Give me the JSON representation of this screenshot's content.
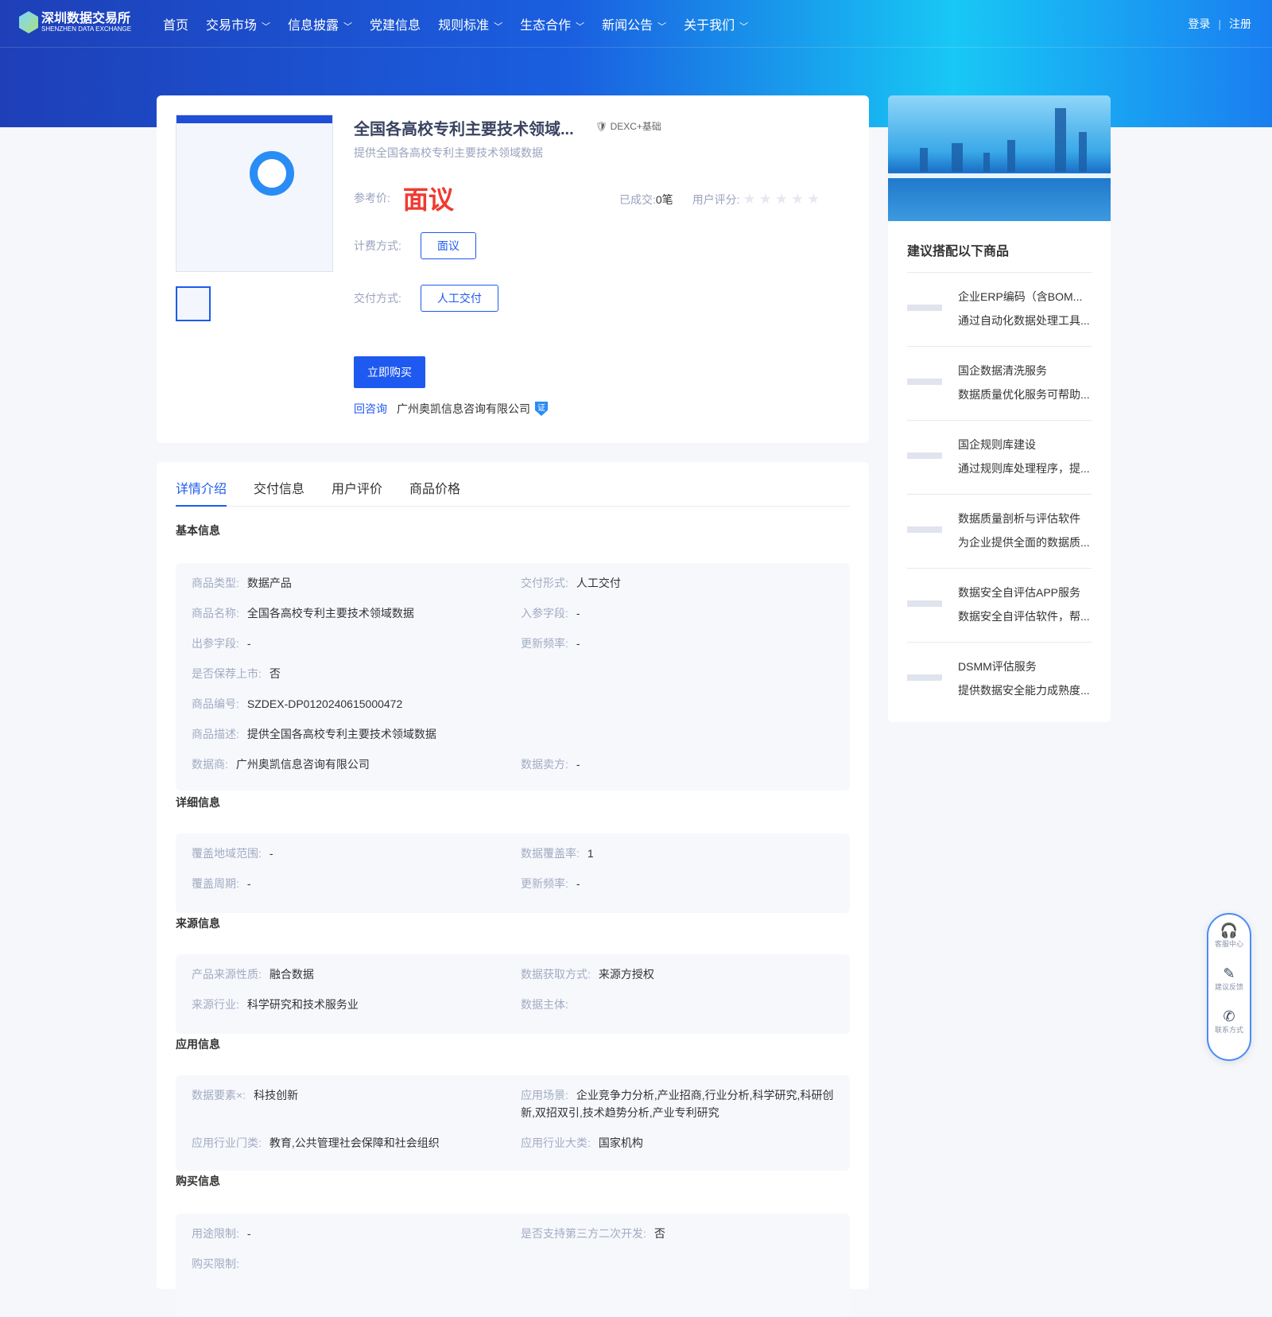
{
  "header": {
    "logo_cn": "深圳数据交易所",
    "logo_en": "SHENZHEN DATA EXCHANGE",
    "menu": [
      {
        "label": "首页",
        "dropdown": false
      },
      {
        "label": "交易市场",
        "dropdown": true
      },
      {
        "label": "信息披露",
        "dropdown": true
      },
      {
        "label": "党建信息",
        "dropdown": false
      },
      {
        "label": "规则标准",
        "dropdown": true
      },
      {
        "label": "生态合作",
        "dropdown": true
      },
      {
        "label": "新闻公告",
        "dropdown": true
      },
      {
        "label": "关于我们",
        "dropdown": true
      }
    ],
    "login": "登录",
    "register": "注册"
  },
  "product": {
    "title": "全国各高校专利主要技术领域...",
    "badge": "DEXC+基础",
    "subtitle": "提供全国各高校专利主要技术领域数据",
    "price_label": "参考价:",
    "price": "面议",
    "sold_label": "已成交:",
    "sold": "0笔",
    "rating_label": "用户评分:",
    "rating": 0,
    "rating_max": 5,
    "billing_label": "计费方式:",
    "billing": "面议",
    "delivery_label": "交付方式:",
    "delivery": "人工交付",
    "buy": "立即购买",
    "consult": "回咨询",
    "seller": "广州奥凯信息咨询有限公司",
    "seller_badge": "证"
  },
  "tabs": [
    "详情介绍",
    "交付信息",
    "用户评价",
    "商品价格"
  ],
  "sections": {
    "basic": {
      "title": "基本信息",
      "fields": [
        [
          "商品类型:",
          "数据产品"
        ],
        [
          "交付形式:",
          "人工交付"
        ],
        [
          "商品名称:",
          "全国各高校专利主要技术领域数据"
        ],
        [
          "入参字段:",
          "-"
        ],
        [
          "出参字段:",
          "-"
        ],
        [
          "更新频率:",
          "-"
        ],
        [
          "是否保荐上市:",
          "否"
        ],
        [
          "商品编号:",
          "SZDEX-DP0120240615000472"
        ],
        [
          "商品描述:",
          "提供全国各高校专利主要技术领域数据"
        ],
        [
          "数据商:",
          "广州奥凯信息咨询有限公司"
        ],
        [
          "数据卖方:",
          "-"
        ]
      ]
    },
    "detail": {
      "title": "详细信息",
      "fields": [
        [
          "覆盖地域范围:",
          "-"
        ],
        [
          "数据覆盖率:",
          "1"
        ],
        [
          "覆盖周期:",
          "-"
        ],
        [
          "更新频率:",
          "-"
        ]
      ]
    },
    "source": {
      "title": "来源信息",
      "fields": [
        [
          "产品来源性质:",
          "融合数据"
        ],
        [
          "数据获取方式:",
          "来源方授权"
        ],
        [
          "来源行业:",
          "科学研究和技术服务业"
        ],
        [
          "数据主体:",
          ""
        ]
      ]
    },
    "app": {
      "title": "应用信息",
      "fields": [
        [
          "数据要素×:",
          "科技创新"
        ],
        [
          "应用场景:",
          "企业竞争力分析,产业招商,行业分析,科学研究,科研创新,双招双引,技术趋势分析,产业专利研究"
        ],
        [
          "应用行业门类:",
          "教育,公共管理社会保障和社会组织"
        ],
        [
          "应用行业大类:",
          "国家机构"
        ]
      ]
    },
    "buy": {
      "title": "购买信息",
      "fields": [
        [
          "用途限制:",
          "-"
        ],
        [
          "是否支持第三方二次开发:",
          "否"
        ],
        [
          "购买限制:",
          ""
        ]
      ]
    }
  },
  "sidebar": {
    "title": "建议搭配以下商品",
    "items": [
      {
        "title": "企业ERP编码（含BOM...",
        "desc": "通过自动化数据处理工具..."
      },
      {
        "title": "国企数据清洗服务",
        "desc": "数据质量优化服务可帮助..."
      },
      {
        "title": "国企规则库建设",
        "desc": "通过规则库处理程序，提..."
      },
      {
        "title": "数据质量剖析与评估软件",
        "desc": "为企业提供全面的数据质..."
      },
      {
        "title": "数据安全自评估APP服务",
        "desc": "数据安全自评估软件，帮..."
      },
      {
        "title": "DSMM评估服务",
        "desc": "提供数据安全能力成熟度..."
      }
    ]
  },
  "float": [
    {
      "icon": "headset-icon",
      "glyph": "🎧",
      "label": "客服中心"
    },
    {
      "icon": "feedback-icon",
      "glyph": "✎",
      "label": "建议反馈"
    },
    {
      "icon": "phone-icon",
      "glyph": "✆",
      "label": "联系方式"
    }
  ]
}
